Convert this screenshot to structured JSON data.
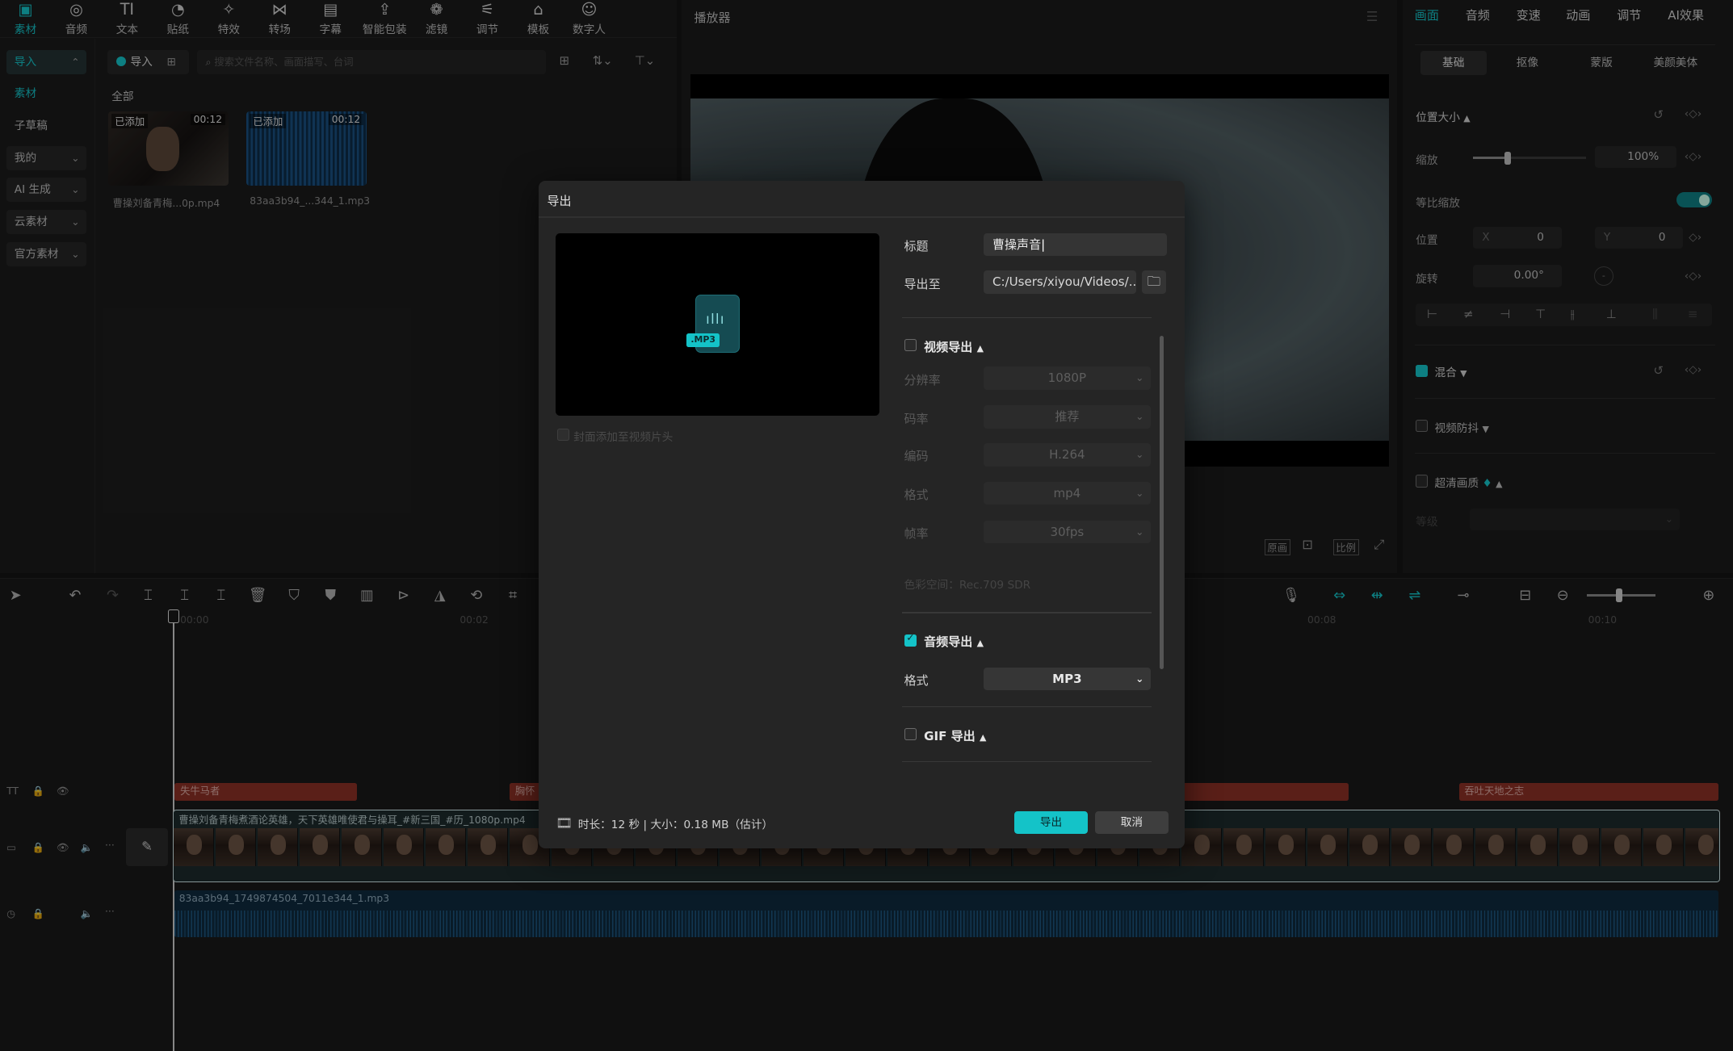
{
  "toolbar": {
    "items": [
      {
        "label": "素材",
        "icon": "media-icon",
        "glyph": "▣"
      },
      {
        "label": "音频",
        "icon": "audio-icon",
        "glyph": "◎"
      },
      {
        "label": "文本",
        "icon": "text-icon",
        "glyph": "TI"
      },
      {
        "label": "贴纸",
        "icon": "sticker-icon",
        "glyph": "◔"
      },
      {
        "label": "特效",
        "icon": "effects-icon",
        "glyph": "✧"
      },
      {
        "label": "转场",
        "icon": "transition-icon",
        "glyph": "⋈"
      },
      {
        "label": "字幕",
        "icon": "subtitle-icon",
        "glyph": "▤"
      },
      {
        "label": "智能包装",
        "icon": "smart-package-icon",
        "glyph": "⇪"
      },
      {
        "label": "滤镜",
        "icon": "filter-icon",
        "glyph": "❁"
      },
      {
        "label": "调节",
        "icon": "adjust-icon",
        "glyph": "⚟"
      },
      {
        "label": "模板",
        "icon": "template-icon",
        "glyph": "⌂"
      },
      {
        "label": "数字人",
        "icon": "digital-human-icon",
        "glyph": "☺"
      }
    ]
  },
  "sidebar": {
    "items": [
      "导入",
      "素材",
      "子草稿",
      "我的",
      "AI 生成",
      "云素材",
      "官方素材"
    ]
  },
  "media": {
    "import_label": "导入",
    "search_placeholder": "搜索文件名称、画面描写、台词",
    "filter_all": "全部",
    "items": [
      {
        "tag": "已添加",
        "duration": "00:12",
        "name": "曹操刘备青梅...0p.mp4"
      },
      {
        "tag": "已添加",
        "duration": "00:12",
        "name": "83aa3b94_...344_1.mp3"
      }
    ]
  },
  "player": {
    "title": "播放器",
    "controls": [
      "原画",
      "比例"
    ]
  },
  "right_panel": {
    "tabs": [
      "画面",
      "音频",
      "变速",
      "动画",
      "调节",
      "AI效果"
    ],
    "subtabs": [
      "基础",
      "抠像",
      "蒙版",
      "美颜美体"
    ],
    "section_position": "位置大小",
    "scale_label": "缩放",
    "scale_value": "100%",
    "scale_level_pct": 30,
    "uniform_label": "等比缩放",
    "position_label": "位置",
    "pos_x_label": "X",
    "pos_x": "0",
    "pos_y_label": "Y",
    "pos_y": "0",
    "rotate_label": "旋转",
    "rotate_value": "0.00°",
    "blend_label": "混合",
    "stabilize_label": "视频防抖",
    "hd_label": "超清画质",
    "hd_sub_label": "等级"
  },
  "timeline": {
    "ruler": [
      "00:00",
      "00:02",
      "00:08",
      "00:10"
    ],
    "text_clips": [
      "失牛马者",
      "胸怀",
      "吞吐天地之志"
    ],
    "video_clip_name": "曹操刘备青梅煮酒论英雄，天下英雄唯使君与操耳_#新三国_#历_1080p.mp4",
    "audio_clip_name": "83aa3b94_1749874504_7011e344_1.mp3"
  },
  "dialog": {
    "title": "导出",
    "preview_badge": ".MP3",
    "add_credits_label": "封面添加至视频片头",
    "title_label": "标题",
    "title_value": "曹操声音",
    "export_to_label": "导出至",
    "export_path": "C:/Users/xiyou/Videos/...",
    "video_section": "视频导出",
    "video_checked": false,
    "resolution_label": "分辨率",
    "resolution_value": "1080P",
    "bitrate_label": "码率",
    "bitrate_value": "推荐",
    "codec_label": "编码",
    "codec_value": "H.264",
    "format_label": "格式",
    "format_value": "mp4",
    "fps_label": "帧率",
    "fps_value": "30fps",
    "color_space": "色彩空间：Rec.709 SDR",
    "audio_section": "音频导出",
    "audio_checked": true,
    "audio_format_label": "格式",
    "audio_format_value": "MP3",
    "gif_section": "GIF 导出",
    "gif_checked": false,
    "summary": "时长：12 秒 | 大小：0.18 MB（估计）",
    "export_button": "导出",
    "cancel_button": "取消"
  },
  "colors": {
    "accent": "#14c3c8",
    "primary_button": "#14c3c8",
    "text_clip": "#8a3026",
    "audio_track": "#0e2a3e"
  }
}
